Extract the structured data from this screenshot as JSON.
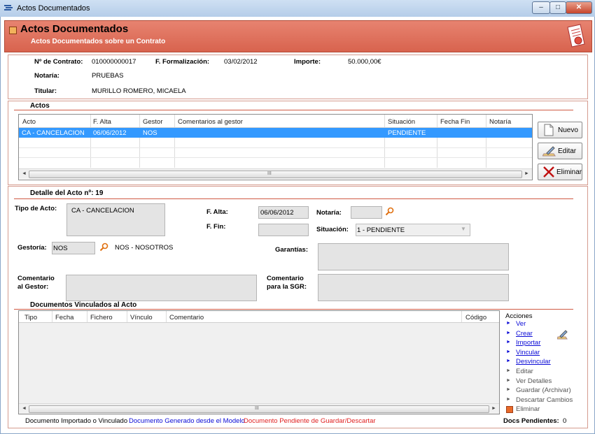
{
  "window": {
    "title": "Actos Documentados",
    "btn_min": "–",
    "btn_max": "□",
    "btn_close": "✕"
  },
  "header": {
    "title": "Actos Documentados",
    "subtitle": "Actos Documentados sobre un Contrato"
  },
  "contract": {
    "contrato_label": "Nº de Contrato:",
    "contrato_value": "010000000017",
    "formalizacion_label": "F. Formalización:",
    "formalizacion_value": "03/02/2012",
    "importe_label": "Importe:",
    "importe_value": "50.000,00€",
    "notaria_label": "Notaría:",
    "notaria_value": "PRUEBAS",
    "titular_label": "Titular:",
    "titular_value": "MURILLO ROMERO, MICAELA"
  },
  "actos": {
    "title": "Actos",
    "columns": [
      "Acto",
      "F. Alta",
      "Gestor",
      "Comentarios al gestor",
      "Situación",
      "Fecha Fin",
      "Notaría"
    ],
    "rows": [
      {
        "acto": "CA - CANCELACION",
        "f_alta": "06/06/2012",
        "gestor": "NOS",
        "comentarios": "",
        "situacion": "PENDIENTE",
        "fecha_fin": "",
        "notaria": ""
      }
    ],
    "scroll_grip": "III",
    "buttons": {
      "nuevo": "Nuevo",
      "editar": "Editar",
      "eliminar": "Eliminar"
    }
  },
  "detalle": {
    "title": "Detalle del Acto nº: 19",
    "tipo_label": "Tipo de Acto:",
    "tipo_value": "CA - CANCELACION",
    "f_alta_label": "F. Alta:",
    "f_alta_value": "06/06/2012",
    "f_fin_label": "F. Fin:",
    "f_fin_value": "",
    "notaria_label": "Notaría:",
    "notaria_value": "",
    "situacion_label": "Situación:",
    "situacion_value": "1 - PENDIENTE",
    "gestoria_label": "Gestoría:",
    "gestoria_code": "NOS",
    "gestoria_name": "NOS - NOSOTROS",
    "garantias_label": "Garantías:",
    "comentario_gestor_label_1": "Comentario",
    "comentario_gestor_label_2": "al Gestor:",
    "comentario_sgr_label_1": "Comentario",
    "comentario_sgr_label_2": "para la SGR:"
  },
  "documentos": {
    "title": "Documentos Vinculados al Acto",
    "columns": [
      "Tipo",
      "Fecha",
      "Fichero",
      "Vínculo",
      "Comentario",
      "Código"
    ],
    "scroll_grip": "III"
  },
  "acciones": {
    "title": "Acciones",
    "enabled": [
      "Ver",
      "Crear",
      "Importar",
      "Vincular",
      "Desvincular"
    ],
    "disabled": [
      "Editar",
      "Ver Detalles",
      "Guardar (Archivar)",
      "Descartar Cambios",
      "Eliminar"
    ]
  },
  "legend": {
    "importado": "Documento Importado o Vinculado",
    "generado": "Documento Generado desde el Modelo",
    "pendiente": "Documento Pendiente de Guardar/Descartar",
    "docs_pendientes_label": "Docs Pendientes:",
    "docs_pendientes_value": "0"
  },
  "colors": {
    "banner": "#d8634e",
    "selection": "#3399ff",
    "link": "#0a0ad6",
    "pending": "#e02020"
  }
}
